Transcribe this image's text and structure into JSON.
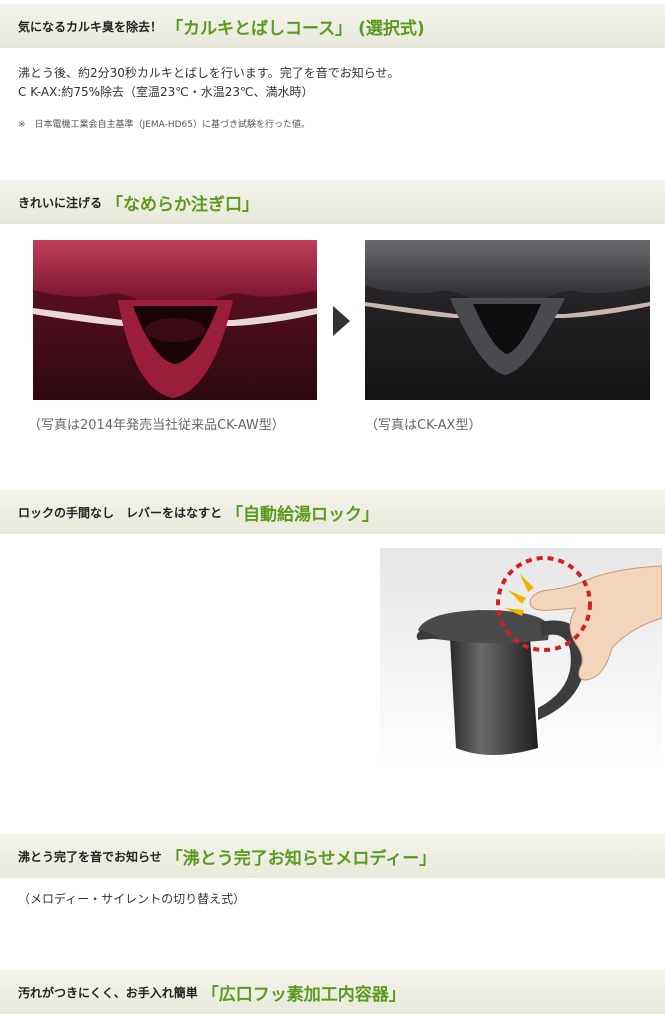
{
  "sections": [
    {
      "lead": "気になるカルキ臭を除去！",
      "feature": "「カルキとばしコース」",
      "feature_suffix": "(選択式)",
      "lines": [
        "沸とう後、約2分30秒カルキとばしを行います。完了を音でお知らせ。",
        "C K-AX:約75%除去（室温23℃・水温23℃、満水時）"
      ],
      "note": "※　日本電機工業会自主基準（JEMA-HD65）に基づき試験を行った値。"
    },
    {
      "lead": "きれいに注げる",
      "feature": "「なめらか注ぎ口」",
      "captions": [
        "（写真は2014年発売当社従来品CK-AW型）",
        "（写真はCK-AX型）"
      ]
    },
    {
      "lead": "ロックの手間なし　レバーをはなすと",
      "feature": "「自動給湯ロック」"
    },
    {
      "lead": "沸とう完了を音でお知らせ",
      "feature": "「沸とう完了お知らせメロディー」",
      "lines": [
        "（メロディー・サイレントの切り替え式）"
      ]
    },
    {
      "lead": "汚れがつきにくく、お手入れ簡単",
      "feature": "「広口フッ素加工内容器」"
    }
  ],
  "colors": {
    "accent_green": "#5a9a1c",
    "bar_background": "#eeeee4",
    "red_kettle": "#8a1a32",
    "gray_kettle": "#3c3c3e",
    "lock_ring": "#d42020",
    "spark_yellow": "#f0b400"
  }
}
